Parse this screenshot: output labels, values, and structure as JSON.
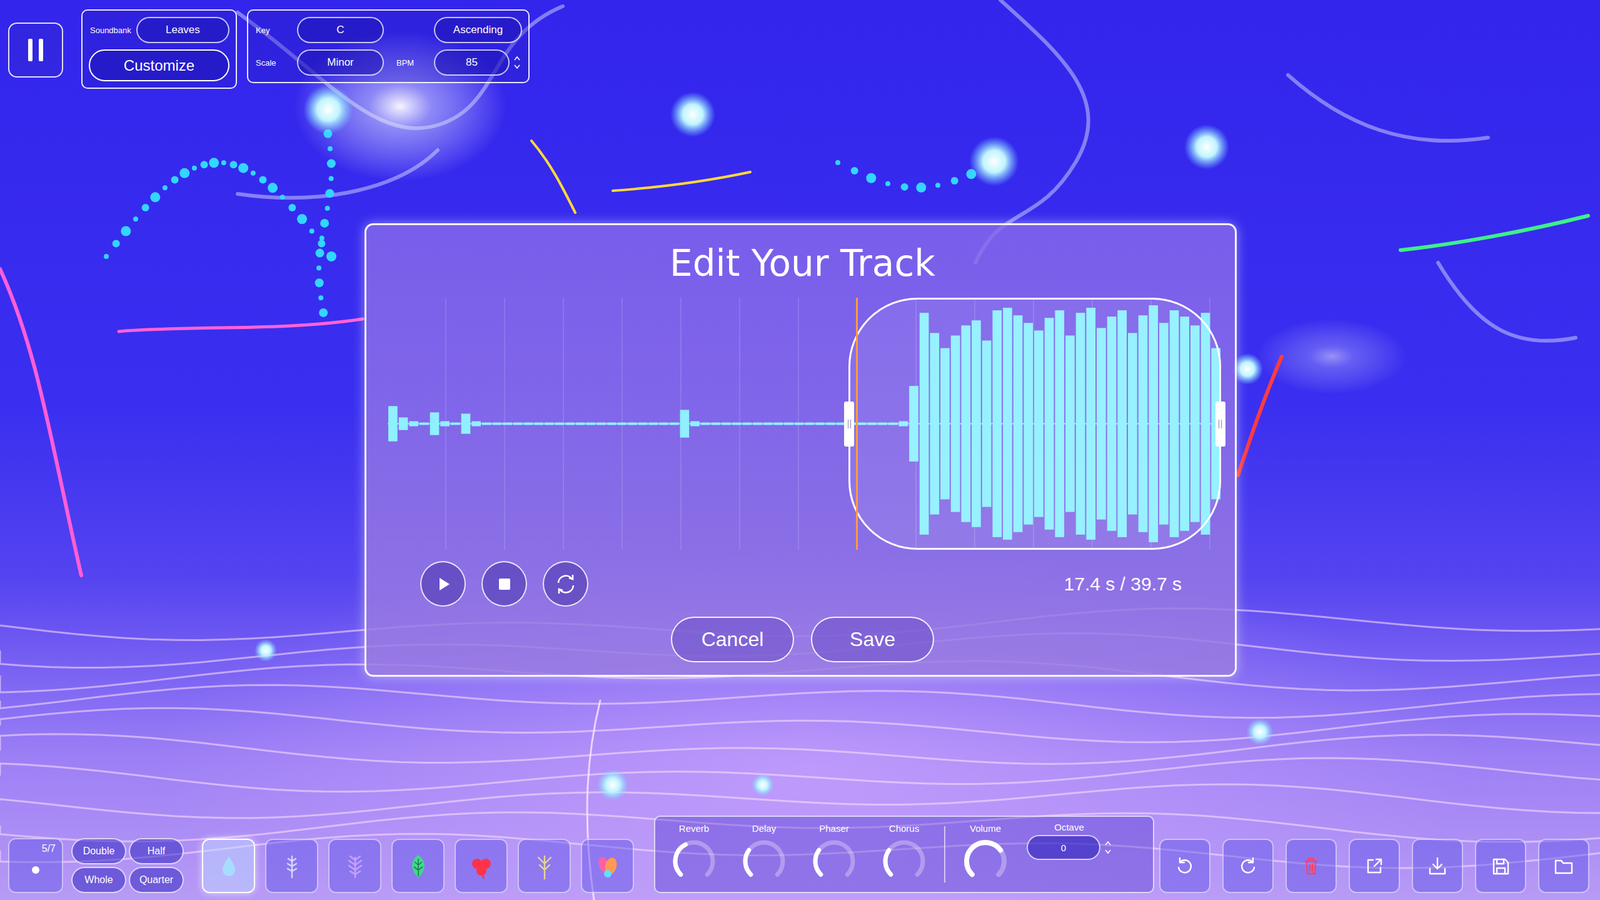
{
  "top_bar": {
    "soundbank": {
      "label": "Soundbank",
      "value": "Leaves"
    },
    "customize": "Customize",
    "key": {
      "label": "Key",
      "value": "C"
    },
    "direction": "Ascending",
    "scale": {
      "label": "Scale",
      "value": "Minor"
    },
    "bpm": {
      "label": "BPM",
      "value": "85"
    }
  },
  "dialog": {
    "title": "Edit Your Track",
    "time": "17.4 s / 39.7 s",
    "selection": {
      "start": 0.553,
      "end": 1.0
    },
    "playhead": 0.563,
    "waveform": [
      0.14,
      0.05,
      0.02,
      0.01,
      0.09,
      0.02,
      0.01,
      0.08,
      0.02,
      0.01,
      0.01,
      0.01,
      0.01,
      0.01,
      0.01,
      0.01,
      0.01,
      0.01,
      0.01,
      0.01,
      0.01,
      0.01,
      0.01,
      0.01,
      0.01,
      0.01,
      0.01,
      0.01,
      0.11,
      0.02,
      0.01,
      0.01,
      0.01,
      0.01,
      0.01,
      0.01,
      0.01,
      0.01,
      0.01,
      0.01,
      0.01,
      0.01,
      0.01,
      0.01,
      0.01,
      0.01,
      0.01,
      0.01,
      0.01,
      0.02,
      0.3,
      0.88,
      0.72,
      0.6,
      0.7,
      0.78,
      0.82,
      0.66,
      0.9,
      0.92,
      0.86,
      0.8,
      0.74,
      0.84,
      0.9,
      0.7,
      0.88,
      0.92,
      0.76,
      0.85,
      0.9,
      0.72,
      0.86,
      0.94,
      0.8,
      0.9,
      0.85,
      0.78,
      0.88,
      0.6
    ],
    "buttons": [
      "Cancel",
      "Save"
    ]
  },
  "note_length": {
    "count": "5/7",
    "options": [
      {
        "label": "Double",
        "selected": false
      },
      {
        "label": "Half",
        "selected": false
      },
      {
        "label": "Whole",
        "selected": false
      },
      {
        "label": "Quarter",
        "selected": false
      }
    ]
  },
  "instruments": [
    {
      "kind": "drop",
      "color": "#a8dcff",
      "selected": true
    },
    {
      "kind": "sprig",
      "color": "#d6d8ff",
      "selected": false
    },
    {
      "kind": "fern",
      "color": "#c9a2ff",
      "selected": false
    },
    {
      "kind": "leaf",
      "color": "#3fd98a",
      "selected": false
    },
    {
      "kind": "clover",
      "color": "#ff3348",
      "selected": false
    },
    {
      "kind": "twig",
      "color": "#e6d596",
      "selected": false
    },
    {
      "kind": "mixed",
      "color": "#ff9a50",
      "selected": false
    }
  ],
  "effects": [
    {
      "label": "Reverb",
      "level": 0.4
    },
    {
      "label": "Delay",
      "level": 0.3
    },
    {
      "label": "Phaser",
      "level": 0.3
    },
    {
      "label": "Chorus",
      "level": 0.3
    }
  ],
  "volume": {
    "label": "Volume",
    "level": 0.7
  },
  "octave": {
    "label": "Octave",
    "value": "0"
  },
  "actions": [
    {
      "kind": "undo",
      "color": "#ffffff"
    },
    {
      "kind": "redo",
      "color": "#ffffff"
    },
    {
      "kind": "delete",
      "color": "#ff4062"
    },
    {
      "kind": "export",
      "color": "#ffffff"
    },
    {
      "kind": "download",
      "color": "#ffffff"
    },
    {
      "kind": "save",
      "color": "#ffffff"
    },
    {
      "kind": "open",
      "color": "#ffffff"
    }
  ]
}
